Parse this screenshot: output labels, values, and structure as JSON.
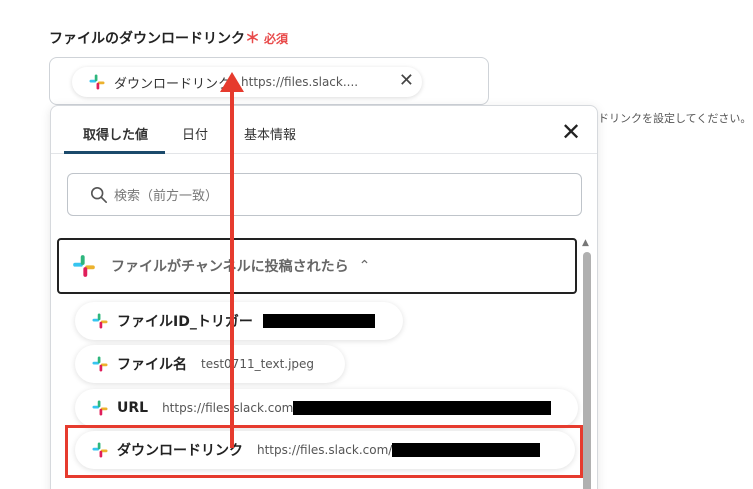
{
  "field": {
    "label": "ファイルのダウンロードリンク",
    "required_star": "＊",
    "required_text": "必須",
    "hint": "ドリンクを設定してください。"
  },
  "selected_chip": {
    "name": "ダウンロードリンク",
    "value": "https://files.slack...."
  },
  "panel": {
    "tabs": [
      "取得した値",
      "日付",
      "基本情報"
    ],
    "active_tab": "取得した値",
    "search_placeholder": "検索（前方一致）",
    "group_title": "ファイルがチャンネルに投稿されたら",
    "items": [
      {
        "name": "ファイルID_トリガー",
        "value": ""
      },
      {
        "name": "ファイル名",
        "value": "test0711_text.jpeg"
      },
      {
        "name": "URL",
        "value": "https://files.slack.com"
      },
      {
        "name": "ダウンロードリンク",
        "value": "https://files.slack.com/"
      }
    ]
  },
  "icons": {
    "app_icon": "slack-icon",
    "search": "search-icon",
    "close": "close-icon",
    "collapse": "chevron-up-icon",
    "remove": "remove-x-icon"
  },
  "colors": {
    "required": "#e84a4a",
    "annotation_red": "#e63b2e",
    "tab_underline": "#1b4a6b",
    "redaction": "#000000"
  }
}
